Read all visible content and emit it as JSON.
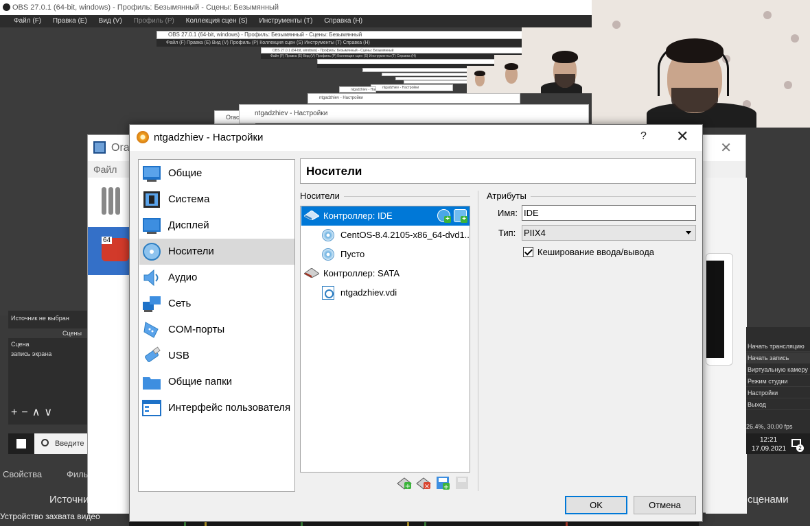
{
  "obs": {
    "title": "OBS 27.0.1 (64-bit, windows) - Профиль: Безымянный - Сцены: Безымянный",
    "menu": [
      "Файл (F)",
      "Правка (E)",
      "Вид (V)",
      "Профиль (P)",
      "Коллекция сцен (S)",
      "Инструменты (T)",
      "Справка (H)"
    ],
    "nested_title": "OBS 27.0.1 (64-bit, windows) - Профиль: Безымянный - Сцены: Безымянный",
    "nested_menu": "Файл (F)   Правка (E)   Вид (V)   Профиль (P)   Коллекция сцен (S)   Инструменты (T)   Справка (H)",
    "nested_dialog_title": "ntgadzhiev - Настройки",
    "nested_vbox": "Orac",
    "source_none": "Источник не выбран",
    "scenes_header": "Сцены",
    "scene_label": "Сцена",
    "scene_item": "запись экрана",
    "properties": "Свойства",
    "filters": "Филь",
    "sources_header": "Источни",
    "scenes_transitions": "сценами",
    "device": "Устройство захвата видео",
    "right_items": [
      "Начать трансляцию",
      "Начать запись",
      "Виртуальную камеру",
      "Режим студии",
      "Настройки",
      "Выход"
    ],
    "fps": "26.4%, 30.00 fps",
    "search_placeholder": "Введите",
    "time": "12:21",
    "date": "17.09.2021",
    "notif_count": "2"
  },
  "vbox_manager": {
    "title": "Orac",
    "menu_file": "Файл",
    "vm_badge": "64"
  },
  "dialog": {
    "title": "ntgadzhiev - Настройки",
    "help": "?",
    "close": "✕",
    "nav": [
      {
        "label": "Общие",
        "icon": "general-icon"
      },
      {
        "label": "Система",
        "icon": "system-icon"
      },
      {
        "label": "Дисплей",
        "icon": "display-icon"
      },
      {
        "label": "Носители",
        "icon": "storage-icon"
      },
      {
        "label": "Аудио",
        "icon": "audio-icon"
      },
      {
        "label": "Сеть",
        "icon": "network-icon"
      },
      {
        "label": "COM-порты",
        "icon": "serial-ports-icon"
      },
      {
        "label": "USB",
        "icon": "usb-icon"
      },
      {
        "label": "Общие папки",
        "icon": "shared-folders-icon"
      },
      {
        "label": "Интерфейс пользователя",
        "icon": "user-interface-icon"
      }
    ],
    "section_title": "Носители",
    "storage_group": "Носители",
    "attributes_group": "Атрибуты",
    "tree": {
      "controller_ide": "Контроллер: IDE",
      "ide_disc": "CentOS-8.4.2105-x86_64-dvd1...",
      "ide_empty": "Пусто",
      "controller_sata": "Контроллер: SATA",
      "sata_disk": "ntgadzhiev.vdi"
    },
    "name_label": "Имя:",
    "name_value": "IDE",
    "type_label": "Тип:",
    "type_value": "PIIX4",
    "cache_label": "Кеширование ввода/вывода",
    "cache_checked": true,
    "ok": "OK",
    "cancel": "Отмена"
  }
}
